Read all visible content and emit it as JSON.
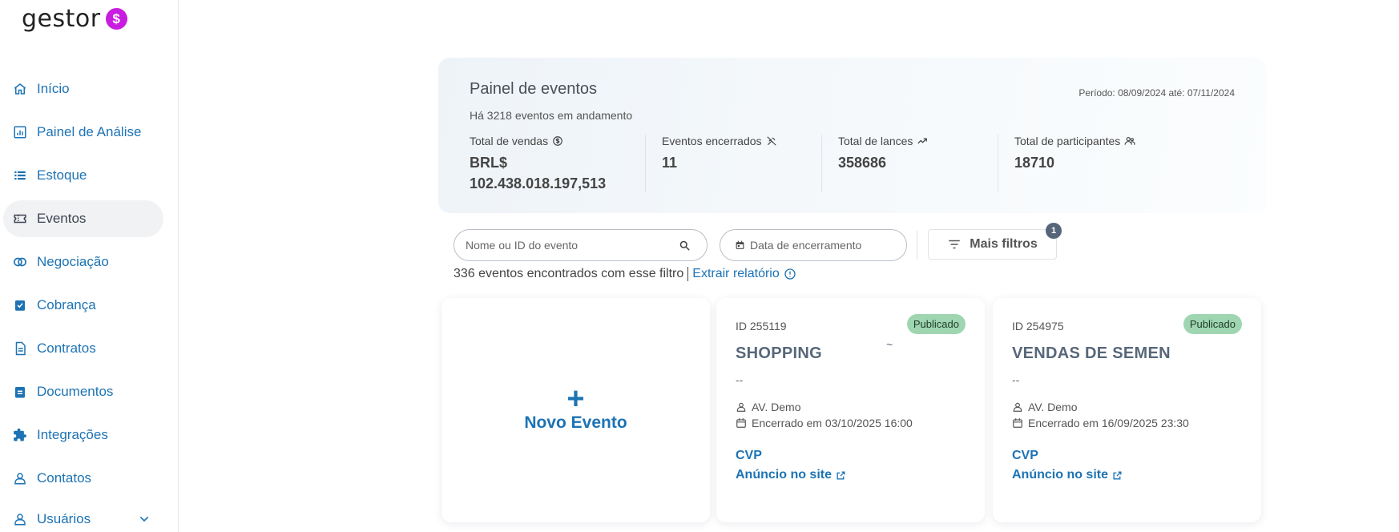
{
  "brand": {
    "name": "gestor",
    "badge_symbol": "$",
    "badge_color": "#c81ce0"
  },
  "sidebar": {
    "items": [
      {
        "label": "Início",
        "icon": "home-icon"
      },
      {
        "label": "Painel de Análise",
        "icon": "chart-icon"
      },
      {
        "label": "Estoque",
        "icon": "list-icon"
      },
      {
        "label": "Eventos",
        "icon": "ticket-icon",
        "active": true
      },
      {
        "label": "Negociação",
        "icon": "circles-icon"
      },
      {
        "label": "Cobrança",
        "icon": "clipboard-check-icon"
      },
      {
        "label": "Contratos",
        "icon": "document-icon"
      },
      {
        "label": "Documentos",
        "icon": "clipboard-icon"
      },
      {
        "label": "Integrações",
        "icon": "puzzle-icon"
      },
      {
        "label": "Contatos",
        "icon": "person-icon"
      },
      {
        "label": "Usuários",
        "icon": "person-icon",
        "expandable": true
      }
    ]
  },
  "panel": {
    "title": "Painel de eventos",
    "subtitle": "Há 3218 eventos em andamento",
    "period": "Período: 08/09/2024 até: 07/11/2024",
    "stats": [
      {
        "label": "Total de vendas",
        "value_line1": "BRL$",
        "value_line2": "102.438.018.197,513",
        "icon": "dollar-circle-icon"
      },
      {
        "label": "Eventos encerrados",
        "value_line1": "11",
        "value_line2": "",
        "icon": "gavel-off-icon"
      },
      {
        "label": "Total de lances",
        "value_line1": "358686",
        "value_line2": "",
        "icon": "trending-up-icon"
      },
      {
        "label": "Total de participantes",
        "value_line1": "18710",
        "value_line2": "",
        "icon": "group-icon"
      }
    ]
  },
  "filters": {
    "search_placeholder": "Nome ou ID do evento",
    "date_placeholder": "Data de encerramento",
    "more_filters_label": "Mais filtros",
    "more_filters_count": "1",
    "results_text": "336 eventos encontrados com esse filtro",
    "export_label": "Extrair relatório"
  },
  "new_event": {
    "plus": "+",
    "label": "Novo Evento"
  },
  "events": [
    {
      "id": "ID 255119",
      "status": "Publicado",
      "name": "SHOPPING",
      "tilde": "~",
      "dash": "--",
      "seller": "AV. Demo",
      "closed": "Encerrado em 03/10/2025 16:00",
      "type": "CVP",
      "link": "Anúncio no site"
    },
    {
      "id": "ID 254975",
      "status": "Publicado",
      "name": "VENDAS DE SEMEN",
      "tilde": "",
      "dash": "--",
      "seller": "AV. Demo",
      "closed": "Encerrado em 16/09/2025 23:30",
      "type": "CVP",
      "link": "Anúncio no site"
    }
  ],
  "colors": {
    "link": "#1d73b4",
    "status_bg": "#9fd6b1",
    "badge": "#56667a"
  }
}
